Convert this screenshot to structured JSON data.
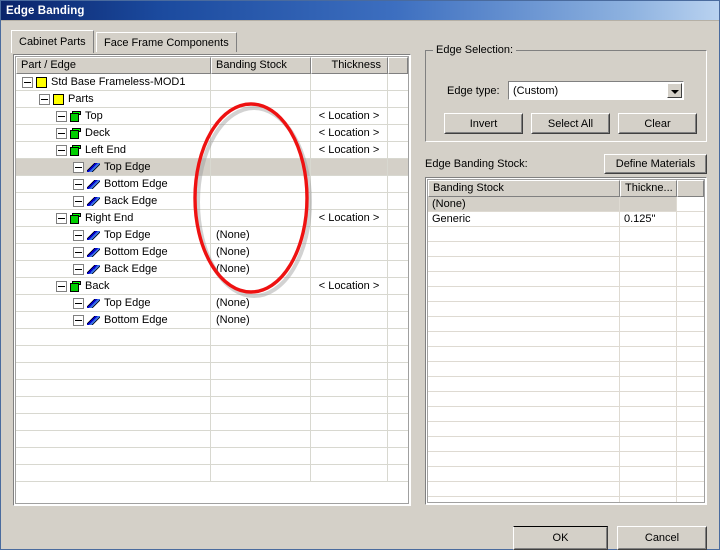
{
  "window": {
    "title": "Edge Banding"
  },
  "tabs": [
    {
      "label": "Cabinet Parts",
      "active": true
    },
    {
      "label": "Face Frame Components",
      "active": false
    }
  ],
  "grid": {
    "columns": [
      "Part / Edge",
      "Banding Stock",
      "Thickness",
      ""
    ],
    "rows": [
      {
        "indent": 0,
        "icon": "yellow-box-icon",
        "label": "Std Base Frameless-MOD1",
        "banding": "",
        "thickness": "",
        "selected": false
      },
      {
        "indent": 1,
        "icon": "yellow-box-icon",
        "label": "Parts",
        "banding": "",
        "thickness": "",
        "selected": false
      },
      {
        "indent": 2,
        "icon": "green-part-icon",
        "label": "Top",
        "banding": "",
        "thickness": "< Location >",
        "selected": false
      },
      {
        "indent": 2,
        "icon": "green-part-icon",
        "label": "Deck",
        "banding": "",
        "thickness": "< Location >",
        "selected": false
      },
      {
        "indent": 2,
        "icon": "green-part-icon",
        "label": "Left End",
        "banding": "",
        "thickness": "< Location >",
        "selected": false
      },
      {
        "indent": 3,
        "icon": "blue-edge-icon",
        "label": "Top Edge",
        "banding": "",
        "thickness": "",
        "selected": true
      },
      {
        "indent": 3,
        "icon": "blue-edge-icon",
        "label": "Bottom Edge",
        "banding": "",
        "thickness": "",
        "selected": false
      },
      {
        "indent": 3,
        "icon": "blue-edge-icon",
        "label": "Back Edge",
        "banding": "",
        "thickness": "",
        "selected": false
      },
      {
        "indent": 2,
        "icon": "green-part-icon",
        "label": "Right End",
        "banding": "",
        "thickness": "< Location >",
        "selected": false
      },
      {
        "indent": 3,
        "icon": "blue-edge-icon",
        "label": "Top Edge",
        "banding": "(None)",
        "thickness": "",
        "selected": false
      },
      {
        "indent": 3,
        "icon": "blue-edge-icon",
        "label": "Bottom Edge",
        "banding": "(None)",
        "thickness": "",
        "selected": false
      },
      {
        "indent": 3,
        "icon": "blue-edge-icon",
        "label": "Back Edge",
        "banding": "(None)",
        "thickness": "",
        "selected": false
      },
      {
        "indent": 2,
        "icon": "green-part-icon",
        "label": "Back",
        "banding": "",
        "thickness": "< Location >",
        "selected": false
      },
      {
        "indent": 3,
        "icon": "blue-edge-icon",
        "label": "Top Edge",
        "banding": "(None)",
        "thickness": "",
        "selected": false
      },
      {
        "indent": 3,
        "icon": "blue-edge-icon",
        "label": "Bottom Edge",
        "banding": "(None)",
        "thickness": "",
        "selected": false
      }
    ],
    "empty_row_count": 9
  },
  "grid_combo": {
    "value": "(None)",
    "options": [
      {
        "label": "(None)",
        "highlighted": true
      },
      {
        "label": "Generic",
        "highlighted": false
      }
    ]
  },
  "edge_selection": {
    "group_label": "Edge Selection:",
    "edge_type_label": "Edge type:",
    "edge_type_value": "(Custom)",
    "invert_label": "Invert",
    "select_all_label": "Select All",
    "clear_label": "Clear"
  },
  "stock": {
    "section_label": "Edge Banding Stock:",
    "define_materials_label": "Define Materials",
    "columns": [
      "Banding Stock",
      "Thickne...",
      ""
    ],
    "rows": [
      {
        "name": "(None)",
        "thickness": "",
        "selected": true
      },
      {
        "name": "Generic",
        "thickness": "0.125\"",
        "selected": false
      }
    ],
    "empty_row_count": 19
  },
  "footer": {
    "ok_label": "OK",
    "cancel_label": "Cancel"
  },
  "annotation": {
    "shape": "red-ellipse-highlight",
    "color": "#ee1111"
  }
}
